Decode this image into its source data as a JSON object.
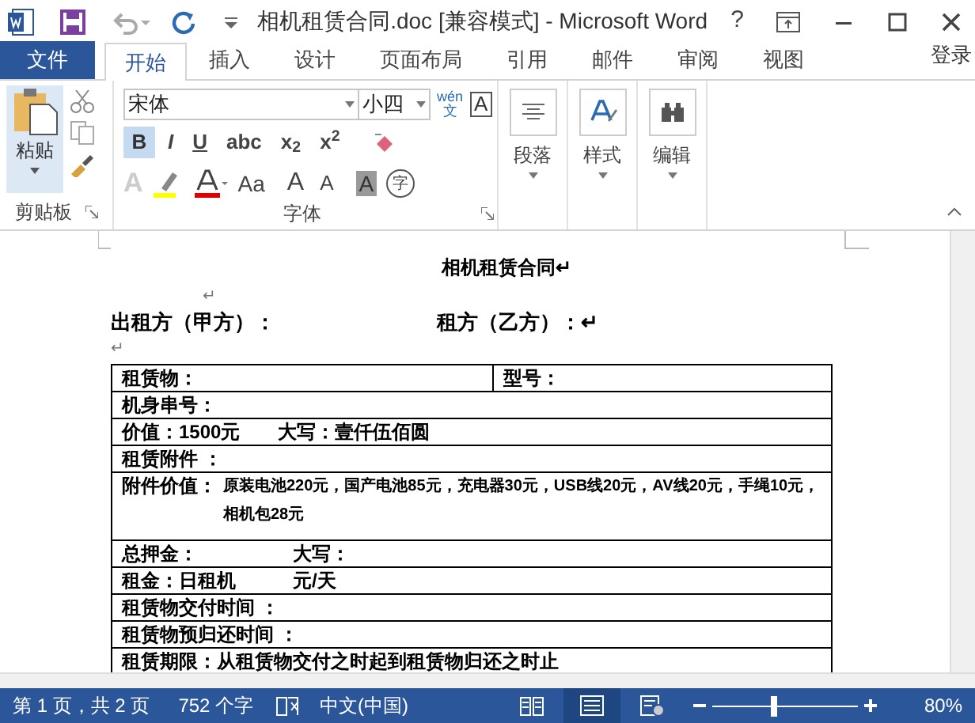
{
  "window": {
    "title": "相机租赁合同.doc [兼容模式] - Microsoft Word",
    "help": "?"
  },
  "tabs": [
    {
      "label": "文件",
      "kind": "file",
      "selected": false
    },
    {
      "label": "开始",
      "kind": "tab",
      "selected": true
    },
    {
      "label": "插入",
      "kind": "tab",
      "selected": false
    },
    {
      "label": "设计",
      "kind": "tab",
      "selected": false
    },
    {
      "label": "页面布局",
      "kind": "tab",
      "selected": false
    },
    {
      "label": "引用",
      "kind": "tab",
      "selected": false
    },
    {
      "label": "邮件",
      "kind": "tab",
      "selected": false
    },
    {
      "label": "审阅",
      "kind": "tab",
      "selected": false
    },
    {
      "label": "视图",
      "kind": "tab",
      "selected": false
    }
  ],
  "sign_in": "登录",
  "ribbon": {
    "clipboard": {
      "paste": "粘贴",
      "label": "剪贴板"
    },
    "font": {
      "name": "宋体",
      "size": "小四",
      "phonetic": "wén",
      "phonetic_char": "文",
      "label": "字体",
      "bold": {
        "label": "B",
        "selected": true
      },
      "buttons": [
        "*I*",
        "U",
        "abc",
        "x$_{2}$",
        "x$^{2}$"
      ],
      "border_char": "A",
      "effects": "A",
      "case": "Aa",
      "grow": "A",
      "shrink": "A",
      "shading": "A",
      "enclose": "字"
    },
    "paragraph": "段落",
    "styles": "样式",
    "editing": "编辑"
  },
  "document": {
    "title": "相机租赁合同↵",
    "blank": "↵",
    "lessor": "出租方（甲方）：",
    "lessee": "租方（乙方）：↵",
    "blank2": "↵",
    "rows": [
      {
        "cells": [
          {
            "text": "租赁物："
          },
          {
            "text": "型号："
          }
        ]
      },
      {
        "cells": [
          {
            "text": "机身串号："
          }
        ]
      },
      {
        "cells": [
          {
            "text": "价值：1500元　　大写：壹仟伍佰圆"
          }
        ]
      },
      {
        "cells": [
          {
            "text": "租赁附件 ："
          }
        ]
      },
      {
        "cells": [
          {
            "label": "附件价值：",
            "text": "原装电池220元，国产电池85元，充电器30元，USB线20元，AV线20元，手绳10元，相机包28元"
          }
        ]
      },
      {
        "cells": [
          {
            "text": "总押金：　　　　　大写："
          }
        ]
      },
      {
        "cells": [
          {
            "text": "租金：日租机　　　元/天"
          }
        ]
      },
      {
        "cells": [
          {
            "text": "租赁物交付时间 ："
          }
        ]
      },
      {
        "cells": [
          {
            "text": "租赁物预归还时间 ："
          }
        ]
      },
      {
        "cells": [
          {
            "text": "租赁期限：从租赁物交付之时起到租赁物归还之时止"
          }
        ]
      }
    ]
  },
  "status_bar": {
    "page": "第 1 页，共 2 页",
    "words": "752 个字",
    "language": "中文(中国)",
    "zoom": {
      "level": 0.42
    },
    "zoom_reading": "80%"
  }
}
